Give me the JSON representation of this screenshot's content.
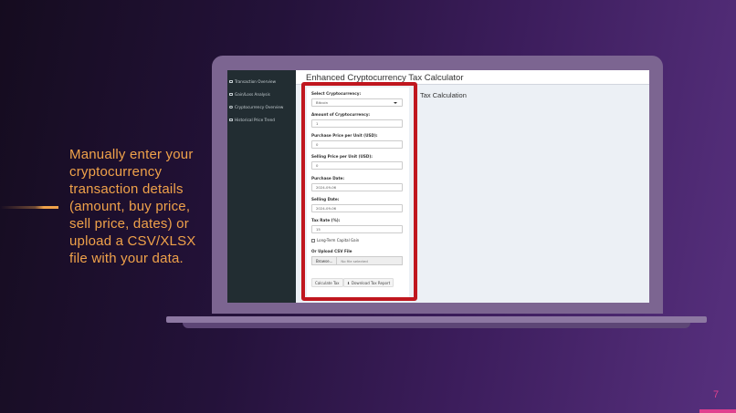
{
  "slide": {
    "caption": "Manually enter your cryptocurrency transaction details (amount, buy price, sell price, dates) or upload a CSV/XLSX file with your data.",
    "page_number": "7"
  },
  "colors": {
    "caption": "#f0a24a",
    "highlight": "#c0171f",
    "sidebar": "#222d32",
    "page_number": "#e0408f"
  },
  "app": {
    "title": "Enhanced Cryptocurrency Tax Calculator",
    "result_title": "Tax Calculation",
    "sidebar": [
      {
        "label": "Transaction Overview",
        "icon": "table-icon"
      },
      {
        "label": "Gain/Loss Analysis",
        "icon": "line-chart-icon"
      },
      {
        "label": "Cryptocurrency Overview",
        "icon": "pie-chart-icon"
      },
      {
        "label": "Historical Price Trend",
        "icon": "line-chart-icon"
      }
    ],
    "form": {
      "crypto_label": "Select Cryptocurrency:",
      "crypto_value": "Bitcoin",
      "amount_label": "Amount of Cryptocurrency:",
      "amount_value": "1",
      "purchase_price_label": "Purchase Price per Unit (USD):",
      "purchase_price_value": "0",
      "selling_price_label": "Selling Price per Unit (USD):",
      "selling_price_value": "0",
      "purchase_date_label": "Purchase Date:",
      "purchase_date_value": "2024-09-06",
      "selling_date_label": "Selling Date:",
      "selling_date_value": "2024-09-06",
      "tax_rate_label": "Tax Rate (%):",
      "tax_rate_value": "15",
      "long_term_label": "Long-Term Capital Gain",
      "upload_label": "Or Upload CSV File",
      "browse_label": "Browse...",
      "file_status": "No file selected",
      "calculate_label": "Calculate Tax",
      "download_label": "Download Tax Report"
    }
  }
}
